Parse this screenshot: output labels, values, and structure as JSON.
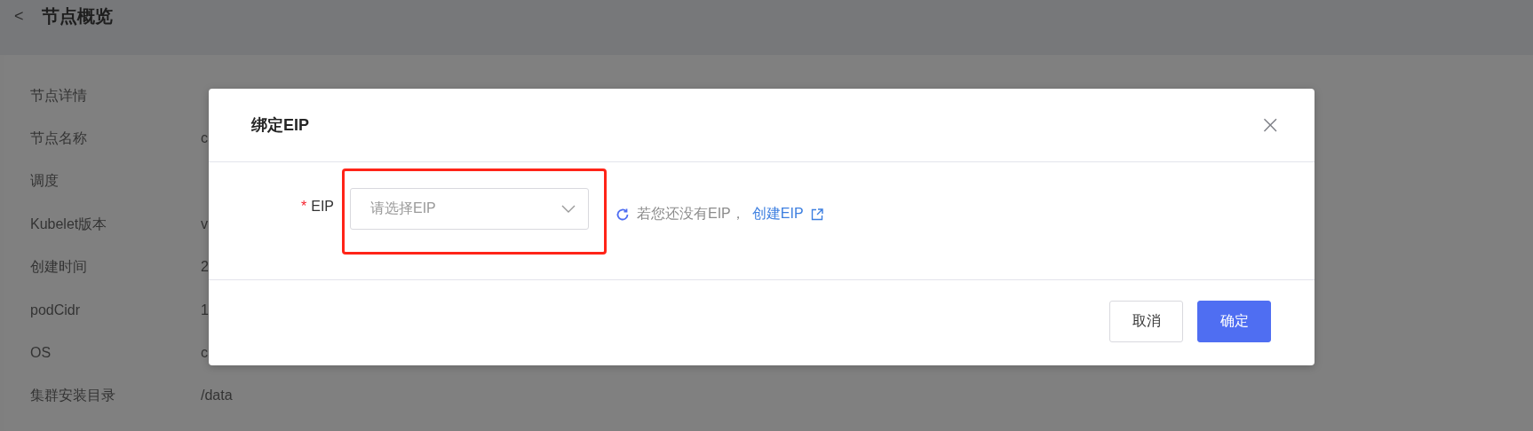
{
  "page": {
    "back": "<",
    "title": "节点概览"
  },
  "details": [
    {
      "label": "节点详情"
    },
    {
      "label": "节点名称",
      "value": "c"
    },
    {
      "label": "调度"
    },
    {
      "label": "Kubelet版本",
      "value": "v"
    },
    {
      "label": "创建时间",
      "value": "2"
    },
    {
      "label": "podCidr",
      "value": "1"
    },
    {
      "label": "OS",
      "value": "c"
    },
    {
      "label": "集群安装目录",
      "value": "/data"
    }
  ],
  "dialog": {
    "title": "绑定EIP",
    "close": "×",
    "field": {
      "label": "EIP",
      "required": true,
      "required_mark": "*",
      "placeholder": "请选择EIP"
    },
    "hint": "若您还没有EIP，",
    "link": "创建EIP",
    "buttons": [
      {
        "label": "取消",
        "kind": "default"
      },
      {
        "label": "确定",
        "kind": "primary"
      }
    ]
  }
}
